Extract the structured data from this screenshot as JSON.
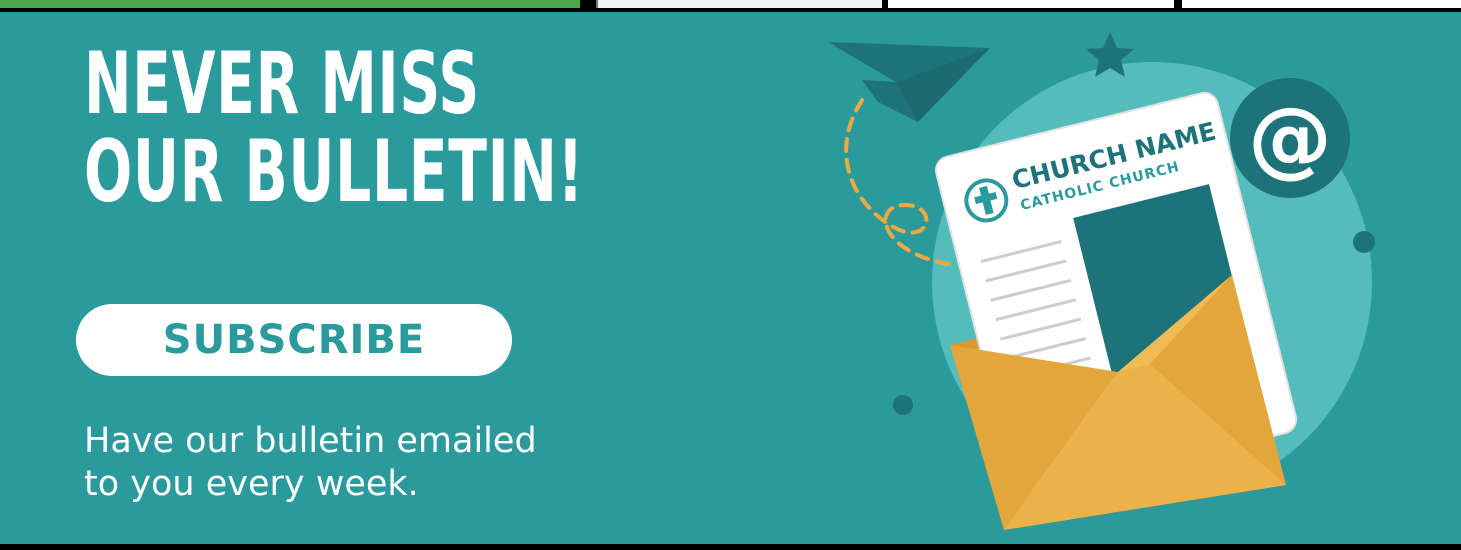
{
  "banner": {
    "headline_line1": "NEVER MISS",
    "headline_line2": "OUR BULLETIN!",
    "subscribe_label": "SUBSCRIBE",
    "tagline_line1": "Have our bulletin emailed",
    "tagline_line2": "to you every week."
  },
  "illustration": {
    "church_name": "CHURCH NAME",
    "church_subtitle": "CATHOLIC CHURCH",
    "at_symbol": "@",
    "icons": [
      "paper-plane-icon",
      "star-icon",
      "envelope-icon",
      "newsletter-icon",
      "cross-logo-icon",
      "at-sign-icon"
    ]
  },
  "colors": {
    "background_teal": "#2a9a9c",
    "dark_teal": "#1d7379",
    "light_teal": "#55bcbc",
    "envelope_yellow": "#ecb24a",
    "envelope_dark": "#d99a30",
    "white": "#ffffff",
    "top_green": "#4ea84a"
  }
}
